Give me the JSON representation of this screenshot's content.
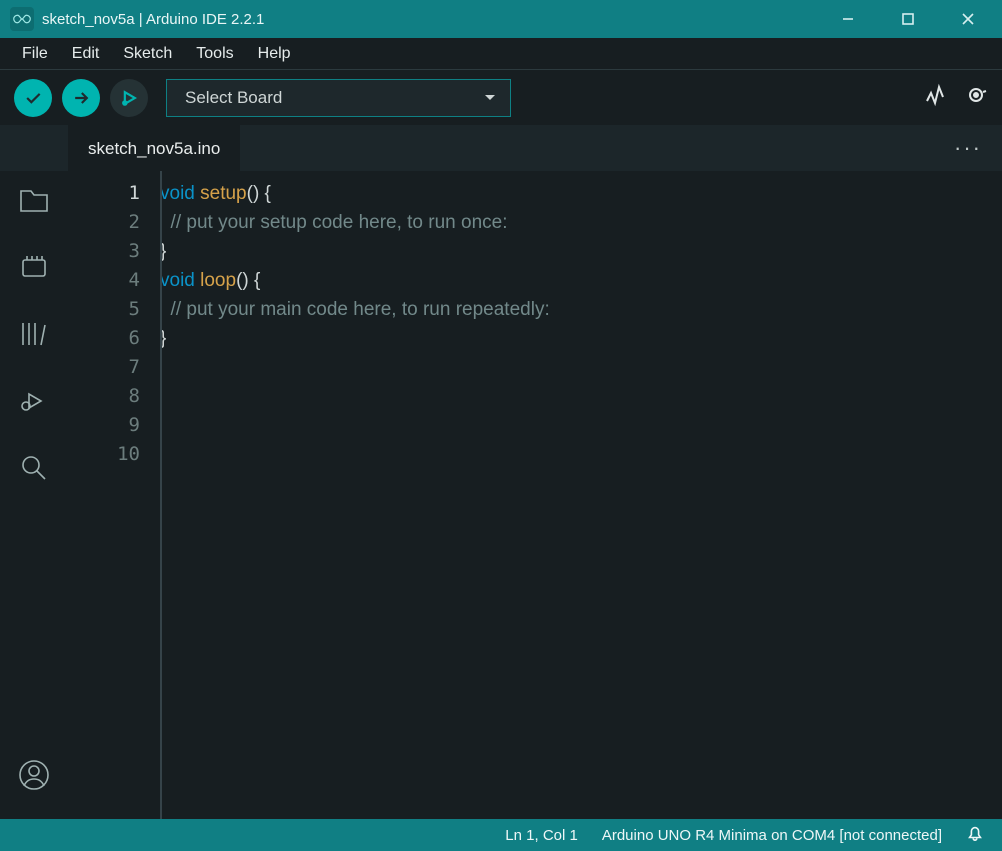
{
  "window": {
    "title": "sketch_nov5a | Arduino IDE 2.2.1"
  },
  "menus": [
    "File",
    "Edit",
    "Sketch",
    "Tools",
    "Help"
  ],
  "toolbar": {
    "board_placeholder": "Select Board"
  },
  "tab": {
    "filename": "sketch_nov5a.ino"
  },
  "sidebar_items": [
    "folder",
    "board-manager",
    "library-manager",
    "debug",
    "search"
  ],
  "editor": {
    "line_numbers": [
      "1",
      "2",
      "3",
      "4",
      "5",
      "6",
      "7",
      "8",
      "9",
      "10"
    ],
    "active_line": 1,
    "code": {
      "l1": {
        "kw": "void",
        "fn": "setup",
        "rest": "() {"
      },
      "l2": "  // put your setup code here, to run once:",
      "l3": "",
      "l4": "}",
      "l5": "",
      "l6": {
        "kw": "void",
        "fn": "loop",
        "rest": "() {"
      },
      "l7": "  // put your main code here, to run repeatedly:",
      "l8": "",
      "l9": "}",
      "l10": ""
    }
  },
  "status": {
    "cursor": "Ln 1, Col 1",
    "board": "Arduino UNO R4 Minima on COM4 [not connected]"
  }
}
